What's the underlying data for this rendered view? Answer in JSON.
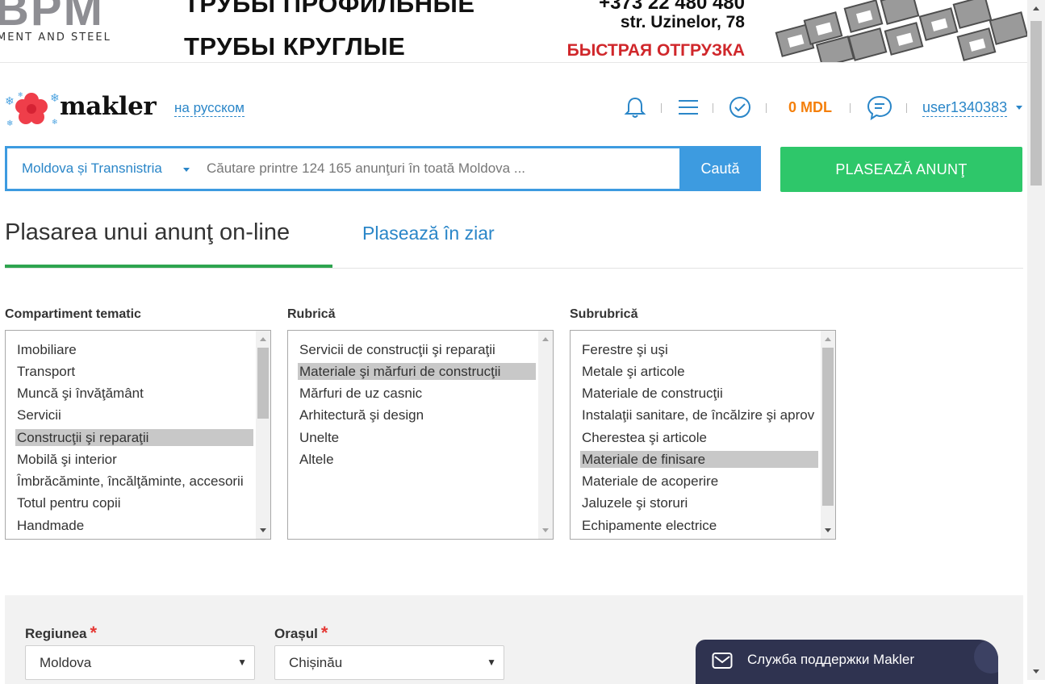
{
  "banner": {
    "logo_text": "BPM",
    "tagline": "MENT AND STEEL",
    "line1": "ТРУБЫ ПРОФИЛЬНЫЕ",
    "line2": "ТРУБЫ КРУГЛЫЕ",
    "phone": "+373 22 480 480",
    "address": "str. Uzinelor, 78",
    "fast_shipping": "БЫСТРАЯ ОТГРУЗКА"
  },
  "header": {
    "logo_text": "makler",
    "language_link": "на русском",
    "balance": "0 MDL",
    "username": "user1340383",
    "icons": [
      "bell-icon",
      "menu-icon",
      "check-circle-icon",
      "chat-icon"
    ]
  },
  "search": {
    "region": "Moldova și Transnistria",
    "placeholder": "Căutare printre 124 165 anunţuri în toată Moldova ...",
    "button": "Caută"
  },
  "post_button": "PLASEAZĂ ANUNŢ",
  "tabs": {
    "online": "Plasarea unui anunţ on-line",
    "paper": "Plasează în ziar"
  },
  "categories": [
    {
      "label": "Compartiment tematic",
      "items": [
        "Imobiliare",
        "Transport",
        "Muncă şi învăţământ",
        "Servicii",
        "Construcţii şi reparaţii",
        "Mobilă şi interior",
        "Îmbrăcăminte, încălţăminte, accesorii",
        "Totul pentru copii",
        "Handmade"
      ],
      "selected": "Construcţii şi reparaţii"
    },
    {
      "label": "Rubrică",
      "items": [
        "Servicii de construcţii şi reparaţii",
        "Materiale şi mărfuri de construcţii",
        "Mărfuri de uz casnic",
        "Arhitectură şi design",
        "Unelte",
        "Altele"
      ],
      "selected": "Materiale şi mărfuri de construcţii"
    },
    {
      "label": "Subrubrică",
      "items": [
        "Ferestre şi uşi",
        "Metale şi articole",
        "Materiale de construcţii",
        "Instalaţii sanitare, de încălzire şi aprov",
        "Cherestea şi articole",
        "Materiale de finisare",
        "Materiale de acoperire",
        "Jaluzele şi storuri",
        "Echipamente electrice"
      ],
      "selected": "Materiale de finisare"
    }
  ],
  "location": {
    "region_label": "Regiunea",
    "region_value": "Moldova",
    "city_label": "Orașul",
    "city_value": "Chișinău",
    "required_mark": "*"
  },
  "support_widget": "Служба поддержки Makler",
  "colors": {
    "accent_blue": "#3d9be0",
    "link_blue": "#2a86c8",
    "green": "#2ec76a",
    "balance_orange": "#f47f0a",
    "selected_gray": "#c8c8c8"
  }
}
